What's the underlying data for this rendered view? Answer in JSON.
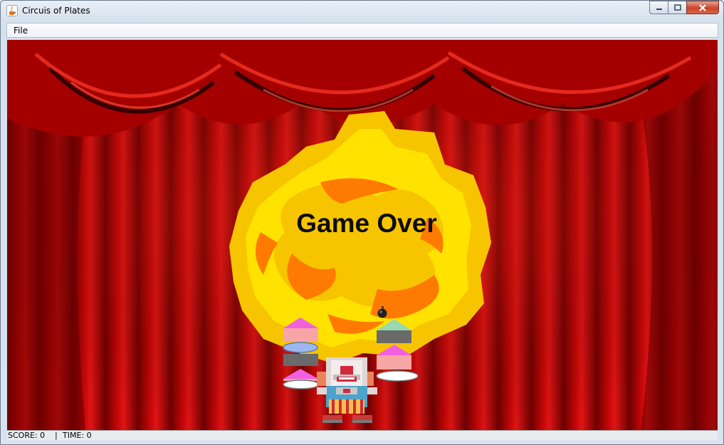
{
  "window": {
    "title": "Circuis of Plates",
    "icon": "java-cup-icon",
    "controls": [
      "minimize-icon",
      "maximize-icon",
      "close-icon"
    ]
  },
  "menu": {
    "items": [
      "File"
    ]
  },
  "game": {
    "message": "Game Over",
    "background": "red-stage-curtain",
    "explosion_colors": [
      "#f7c400",
      "#ffe200",
      "#ff7a00"
    ],
    "left_stack": [
      "pink-cake",
      "blue-plate",
      "gray-plate",
      "pink-cake",
      "white-plate"
    ],
    "right_stack": [
      "green-cake",
      "pink-cake",
      "white-plate"
    ],
    "bomb": "bomb-icon",
    "character": "clown"
  },
  "status": {
    "score": "SCORE: 0",
    "separator": "|",
    "time": "TIME: 0"
  }
}
